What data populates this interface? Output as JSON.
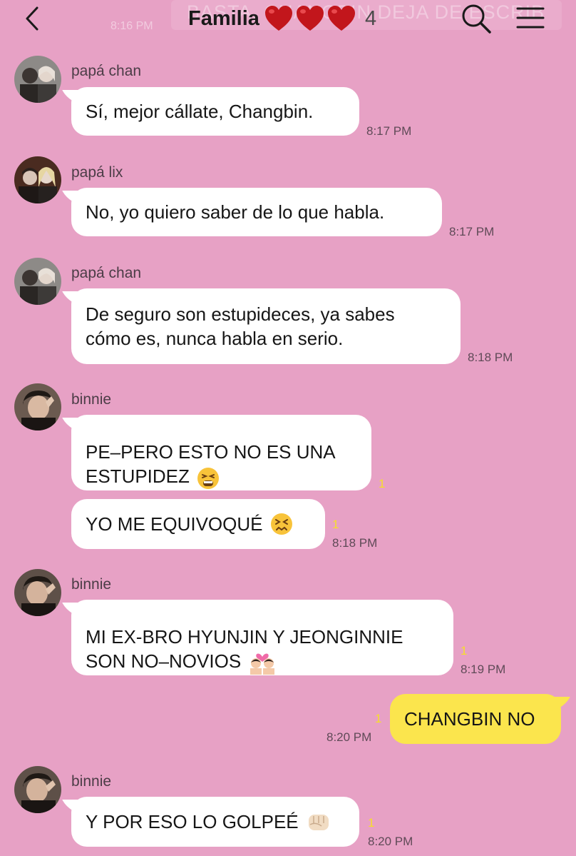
{
  "header": {
    "title": "Familia",
    "member_count": "4",
    "ghost_text": "BASTA, CHANGBIN DEJA DE ESCRIB",
    "ghost_time": "8:16 PM",
    "hearts": [
      "heart-icon",
      "heart-icon",
      "heart-icon"
    ]
  },
  "colors": {
    "background": "#e7a1c5",
    "bubble_other": "#ffffff",
    "bubble_mine": "#fbe54d",
    "unread": "#f6de2a"
  },
  "messages": [
    {
      "sender": "papá chan",
      "text": "Sí, mejor cállate, Changbin.",
      "time": "8:17 PM"
    },
    {
      "sender": "papá lix",
      "text": "No, yo quiero saber de lo que habla.",
      "time": "8:17 PM"
    },
    {
      "sender": "papá chan",
      "text": "De seguro son estupideces, ya sabes\ncómo es, nunca habla en serio.",
      "time": "8:18 PM"
    },
    {
      "sender": "binnie",
      "text": "PE–PERO ESTO NO ES UNA\nESTUPIDEZ",
      "emoji": "tired-face-emoji",
      "unread": "1"
    },
    {
      "text": "YO ME EQUIVOQUÉ",
      "emoji": "confounded-face-emoji",
      "unread": "1",
      "time": "8:18 PM"
    },
    {
      "sender": "binnie",
      "text": "MI EX-BRO HYUNJIN Y JEONGINNIE\nSON NO–NOVIOS",
      "emoji": "couple-with-heart-emoji",
      "unread": "1",
      "time": "8:19 PM"
    },
    {
      "mine": true,
      "text": "CHANGBIN NO",
      "unread": "1",
      "time": "8:20 PM"
    },
    {
      "sender": "binnie",
      "text": "Y POR ESO LO GOLPEÉ",
      "emoji": "oncoming-fist-emoji",
      "unread": "1",
      "time": "8:20 PM"
    }
  ]
}
